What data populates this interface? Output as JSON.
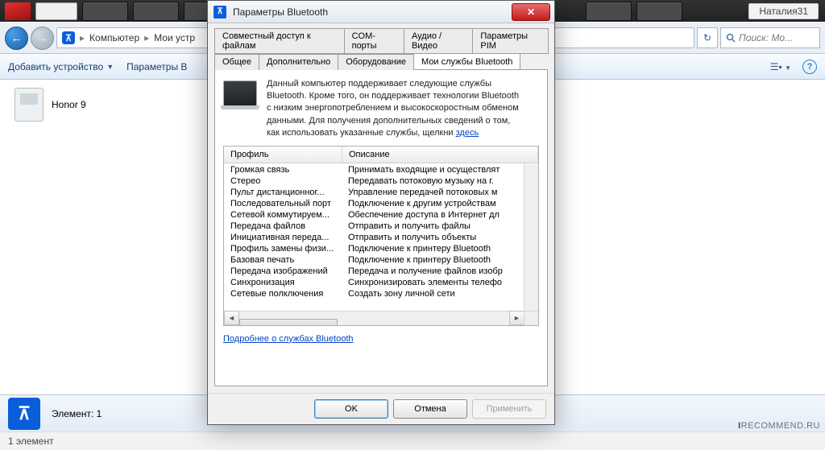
{
  "top": {
    "user": "Наталия31"
  },
  "nav": {
    "crumbs": [
      "Компьютер",
      "Мои устр"
    ],
    "search_placeholder": "Поиск: Мо..."
  },
  "toolbar": {
    "add_device": "Добавить устройство",
    "params": "Параметры B"
  },
  "content": {
    "device_name": "Honor 9",
    "status_label": "Элемент: 1",
    "footer": "1 элемент",
    "watermark_1": "I",
    "watermark_2": "RECOMMEND.RU"
  },
  "dialog": {
    "title": "Параметры Bluetooth",
    "tabs_top": [
      "Совместный доступ к файлам",
      "COM-порты",
      "Аудио / Видео",
      "Параметры PIM"
    ],
    "tabs_bottom": [
      "Общее",
      "Дополнительно",
      "Оборудование",
      "Мои службы Bluetooth"
    ],
    "active_tab": "Мои службы Bluetooth",
    "description_1": "Данный компьютер поддерживает следующие службы",
    "description_2": "Bluetooth. Кроме того, он поддерживает технологии Bluetooth",
    "description_3": "с низким энергопотреблением и высокоскоростным обменом",
    "description_4": "данными. Для получения дополнительных сведений о том,",
    "description_5": "как использовать указанные службы, щелкни",
    "description_link": "здесь",
    "columns": {
      "profile": "Профиль",
      "desc": "Описание"
    },
    "rows": [
      {
        "p": "Громкая связь",
        "d": "Принимать входящие и осуществлят"
      },
      {
        "p": "Стерео",
        "d": "Передавать потоковую музыку на г."
      },
      {
        "p": "Пульт дистанционног...",
        "d": "Управление передачей потоковых м"
      },
      {
        "p": "Последовательный порт",
        "d": "Подключение к другим устройствам"
      },
      {
        "p": "Сетевой коммутируем...",
        "d": "Обеспечение доступа в Интернет дл"
      },
      {
        "p": "Передача файлов",
        "d": "Отправить и получить файлы"
      },
      {
        "p": "Инициативная переда...",
        "d": "Отправить и получить объекты"
      },
      {
        "p": "Профиль замены физи...",
        "d": "Подключение к принтеру Bluetooth"
      },
      {
        "p": "Базовая печать",
        "d": "Подключение к принтеру Bluetooth"
      },
      {
        "p": "Передача изображений",
        "d": "Передача и получение файлов изобр"
      },
      {
        "p": "Синхронизация",
        "d": "Синхронизировать элементы телефо"
      },
      {
        "p": "Сетевые полключения",
        "d": "Создать зону личной сети"
      }
    ],
    "more_link": "Подробнее о службах Bluetooth",
    "ok": "OK",
    "cancel": "Отмена",
    "apply": "Применить"
  }
}
